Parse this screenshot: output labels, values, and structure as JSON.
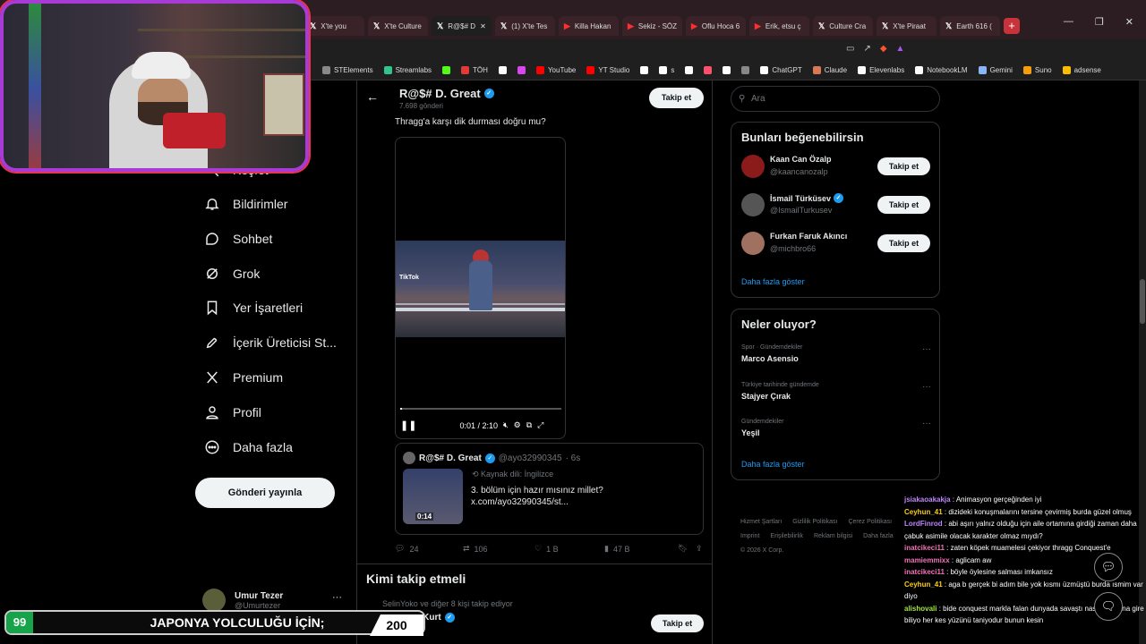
{
  "tabs": [
    {
      "label": "X'te you",
      "icon": "x"
    },
    {
      "label": "X'te Culture",
      "icon": "x"
    },
    {
      "label": "R@$# D",
      "icon": "x",
      "active": true
    },
    {
      "label": "(1) X'te Tes",
      "icon": "x"
    },
    {
      "label": "Killa Hakan",
      "icon": "yt"
    },
    {
      "label": "Sekiz - SÖZ",
      "icon": "yt"
    },
    {
      "label": "Oflu Hoca 6",
      "icon": "yt"
    },
    {
      "label": "Erik, etsu ç",
      "icon": "yt"
    },
    {
      "label": "Culture Cra",
      "icon": "x"
    },
    {
      "label": "X'te Piraat",
      "icon": "x"
    },
    {
      "label": "Earth 616 (",
      "icon": "x"
    }
  ],
  "bookmarks": [
    {
      "label": "STElements",
      "color": "#888888"
    },
    {
      "label": "Streamlabs",
      "color": "#31c48d"
    },
    {
      "label": "",
      "color": "#53fc18"
    },
    {
      "label": "TÖH",
      "color": "#e53935"
    },
    {
      "label": "",
      "color": "#ffffff"
    },
    {
      "label": "",
      "color": "#d946ef"
    },
    {
      "label": "YouTube",
      "color": "#ff0000"
    },
    {
      "label": "YT Studio",
      "color": "#ff0000"
    },
    {
      "label": "",
      "color": "#ffffff"
    },
    {
      "label": "s",
      "color": "#ffffff"
    },
    {
      "label": "",
      "color": "#ffffff"
    },
    {
      "label": "",
      "color": "#ff4f6d"
    },
    {
      "label": "",
      "color": "#ffffff"
    },
    {
      "label": "",
      "color": "#888888"
    },
    {
      "label": "ChatGPT",
      "color": "#ffffff"
    },
    {
      "label": "Claude",
      "color": "#d97757"
    },
    {
      "label": "Elevenlabs",
      "color": "#ffffff"
    },
    {
      "label": "NotebookLM",
      "color": "#ffffff"
    },
    {
      "label": "Gemini",
      "color": "#8ab4f8"
    },
    {
      "label": "Suno",
      "color": "#f59e0b"
    },
    {
      "label": "adsense",
      "color": "#fbbc04"
    }
  ],
  "nav": {
    "explore": "Keşfet",
    "notifications": "Bildirimler",
    "chat": "Sohbet",
    "grok": "Grok",
    "bookmarks": "Yer İşaretleri",
    "creator": "İçerik Üreticisi St...",
    "premium": "Premium",
    "profile": "Profil",
    "more": "Daha fazla",
    "post_button": "Gönderi yayınla"
  },
  "account": {
    "name": "Umur Tezer",
    "handle": "@Umurtezer",
    "more": "···"
  },
  "header": {
    "name": "R@$# D. Great",
    "posts": "7.698 gönderi",
    "follow": "Takip et"
  },
  "post": {
    "text": "Thragg'a karşı dik durması doğru mu?",
    "video": {
      "watermark": "TikTok",
      "time": "0:01 / 2:10",
      "progress": 0.01
    }
  },
  "quote": {
    "name": "R@$# D. Great",
    "handle": "@ayo32990345",
    "time": "· 6s",
    "lang": "Kaynak dili: İngilizce",
    "text": "3. bölüm için hazır mısınız millet? x.com/ayo32990345/st...",
    "duration": "0:14"
  },
  "actions": {
    "replies": "24",
    "reposts": "106",
    "likes": "1 B",
    "views": "47 B"
  },
  "who_to_follow": {
    "title": "Kimi takip etmeli",
    "social": "SelinYoko ve diğer 8 kişi takip ediyor",
    "name": "Berge Kurt",
    "follow": "Takip et"
  },
  "search": {
    "placeholder": "Ara"
  },
  "suggestions": {
    "title": "Bunları beğenebilirsin",
    "items": [
      {
        "name": "Kaan Can Özalp",
        "handle": "@kaancanozalp",
        "verified": false,
        "follow": "Takip et",
        "color": "#8b1a1a"
      },
      {
        "name": "İsmail Türküsev",
        "handle": "@IsmailTurkusev",
        "verified": true,
        "follow": "Takip et",
        "color": "#555555"
      },
      {
        "name": "Furkan Faruk Akıncı",
        "handle": "@michbro66",
        "verified": false,
        "follow": "Takip et",
        "color": "#a07060"
      }
    ],
    "more": "Daha fazla göster"
  },
  "trends": {
    "title": "Neler oluyor?",
    "items": [
      {
        "context": "Spor · Gündemdekiler",
        "topic": "Marco Asensio"
      },
      {
        "context": "Türkiye tarihinde gündemde",
        "topic": "Stajyer Çırak"
      },
      {
        "context": "Gündemdekiler",
        "topic": "Yeşil"
      }
    ],
    "more": "Daha fazla göster"
  },
  "footer": {
    "links": [
      "Hizmet Şartları",
      "Gizlilik Politikası",
      "Çerez Politikası",
      "Imprint",
      "Erişilebilirlik",
      "Reklam bilgisi",
      "Daha fazla"
    ],
    "copyright": "© 2026 X Corp."
  },
  "banner": {
    "left": "99",
    "title": "JAPONYA YOLCULUĞU İÇİN;",
    "right": "200"
  },
  "chat": [
    {
      "user": "jsiakaoakakja",
      "color": "#c084fc",
      "text": "Animasyon gerçeğinden iyi"
    },
    {
      "user": "Ceyhun_41",
      "color": "#facc15",
      "text": "dizideki konuşmalarını tersine çevirmiş burda güzel olmuş"
    },
    {
      "user": "LordFinrod",
      "color": "#c084fc",
      "text": "abi aşırı yalnız olduğu için aile ortamına girdiği zaman daha çabuk asimile olacak karakter olmaz mıydı?"
    },
    {
      "user": "inatcikeci11",
      "color": "#f472b6",
      "text": "zaten köpek muamelesi çekiyor thragg Conquest'e"
    },
    {
      "user": "mamiemmixx",
      "color": "#f472b6",
      "text": "aglicam aw"
    },
    {
      "user": "inatcikeci11",
      "color": "#f472b6",
      "text": "böyle öylesine salması imkansız"
    },
    {
      "user": "Ceyhun_41",
      "color": "#facc15",
      "text": "aga b gerçek bi adım bile yok kısmı üzmüştü burda ısmim var diyo"
    },
    {
      "user": "alishovali",
      "color": "#a3e635",
      "text": "bide conquest markla falan dunyada savaştı nasıl aralarına gire biliyo her kes yüzünü taniyodur bunun kesin"
    }
  ]
}
